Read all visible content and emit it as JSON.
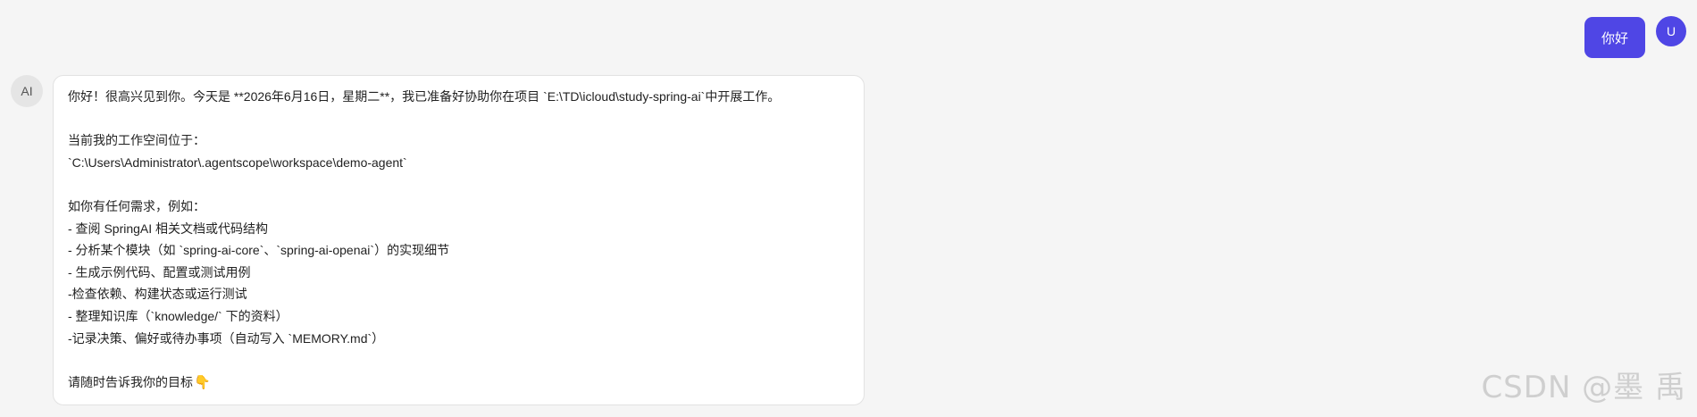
{
  "user_message": {
    "avatar_letter": "U",
    "text": "你好"
  },
  "ai_message": {
    "avatar_label": "AI",
    "lines": [
      "你好！很高兴见到你。今天是 **2026年6月16日，星期二**，我已准备好协助你在项目 `E:\\TD\\icloud\\study-spring-ai`中开展工作。",
      "",
      "当前我的工作空间位于：",
      "`C:\\Users\\Administrator\\.agentscope\\workspace\\demo-agent`",
      "",
      "如你有任何需求，例如：",
      "- 查阅 SpringAI 相关文档或代码结构",
      "- 分析某个模块（如 `spring-ai-core`、`spring-ai-openai`）的实现细节",
      "- 生成示例代码、配置或测试用例",
      "-检查依赖、构建状态或运行测试",
      "- 整理知识库（`knowledge/` 下的资料）",
      "-记录决策、偏好或待办事项（自动写入 `MEMORY.md`）",
      "",
      "请随时告诉我你的目标"
    ],
    "trailing_emoji": "👇"
  },
  "watermark": "CSDN @墨 禹",
  "colors": {
    "accent": "#4f46e5",
    "background": "#f5f5f5"
  }
}
